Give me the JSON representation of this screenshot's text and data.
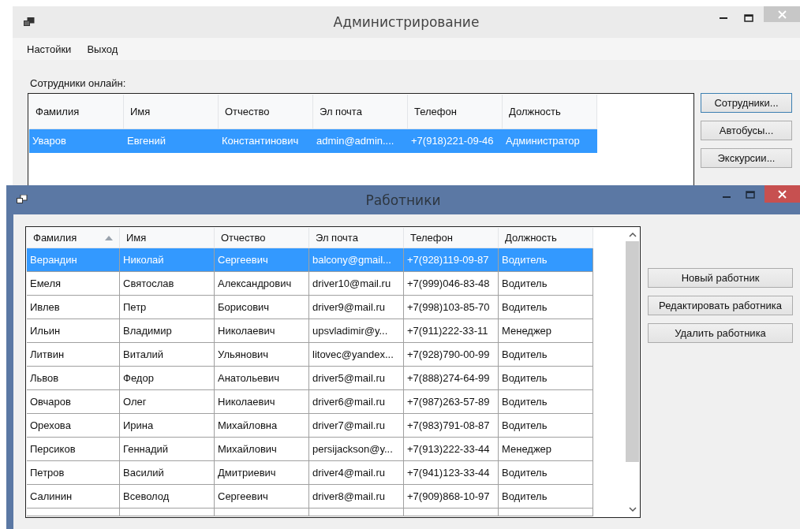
{
  "admin_window": {
    "title": "Администрирование",
    "menu": [
      "Настойки",
      "Выход"
    ],
    "online_label": "Сотрудники онлайн:",
    "table": {
      "columns": [
        {
          "label": "Фамилия",
          "sorted": false
        },
        {
          "label": "Имя",
          "sorted": false
        },
        {
          "label": "Отчество",
          "sorted": false
        },
        {
          "label": "Эл почта",
          "sorted": false
        },
        {
          "label": "Телефон",
          "sorted": false
        },
        {
          "label": "Должность",
          "sorted": false
        }
      ],
      "rows": [
        {
          "selected": true,
          "cells": [
            "Уваров",
            "Евгений",
            "Константинович",
            "admin@admin....",
            "+7(918)221-09-46",
            "Администратор"
          ]
        }
      ]
    },
    "buttons": [
      "Сотрудники...",
      "Автобусы...",
      "Экскурсии..."
    ]
  },
  "workers_window": {
    "title": "Работники",
    "table": {
      "columns": [
        {
          "label": "Фамилия",
          "sorted": true
        },
        {
          "label": "Имя",
          "sorted": false
        },
        {
          "label": "Отчество",
          "sorted": false
        },
        {
          "label": "Эл почта",
          "sorted": false
        },
        {
          "label": "Телефон",
          "sorted": false
        },
        {
          "label": "Должность",
          "sorted": false
        }
      ],
      "rows": [
        {
          "selected": true,
          "cells": [
            "Верандин",
            "Николай",
            "Сергеевич",
            "balcony@gmail...",
            "+7(928)119-09-87",
            "Водитель"
          ]
        },
        {
          "selected": false,
          "cells": [
            "Емеля",
            "Святослав",
            "Александрович",
            "driver10@mail.ru",
            "+7(999)046-83-48",
            "Водитель"
          ]
        },
        {
          "selected": false,
          "cells": [
            "Ивлев",
            "Петр",
            "Борисович",
            "driver9@mail.ru",
            "+7(998)103-85-70",
            "Водитель"
          ]
        },
        {
          "selected": false,
          "cells": [
            "Ильин",
            "Владимир",
            "Николаевич",
            "upsvladimir@y...",
            "+7(911)222-33-11",
            "Менеджер"
          ]
        },
        {
          "selected": false,
          "cells": [
            "Литвин",
            "Виталий",
            "Ульянович",
            "litovec@yandex...",
            "+7(928)790-00-99",
            "Водитель"
          ]
        },
        {
          "selected": false,
          "cells": [
            "Львов",
            "Федор",
            "Анатольевич",
            "driver5@mail.ru",
            "+7(888)274-64-99",
            "Водитель"
          ]
        },
        {
          "selected": false,
          "cells": [
            "Овчаров",
            "Олег",
            "Николаевич",
            "driver6@mail.ru",
            "+7(987)263-57-89",
            "Водитель"
          ]
        },
        {
          "selected": false,
          "cells": [
            "Орехова",
            "Ирина",
            "Михайловна",
            "driver7@mail.ru",
            "+7(983)791-08-87",
            "Водитель"
          ]
        },
        {
          "selected": false,
          "cells": [
            "Персиков",
            "Геннадий",
            "Михайлович",
            "persijackson@y...",
            "+7(913)222-33-44",
            "Менеджер"
          ]
        },
        {
          "selected": false,
          "cells": [
            "Петров",
            "Василий",
            "Дмитриевич",
            "driver4@mail.ru",
            "+7(941)123-33-44",
            "Водитель"
          ]
        },
        {
          "selected": false,
          "cells": [
            "Салинин",
            "Всеволод",
            "Сергеевич",
            "driver8@mail.ru",
            "+7(909)868-10-97",
            "Водитель"
          ]
        }
      ]
    },
    "buttons": [
      "Новый работник",
      "Редактировать работника",
      "Удалить работника"
    ]
  }
}
